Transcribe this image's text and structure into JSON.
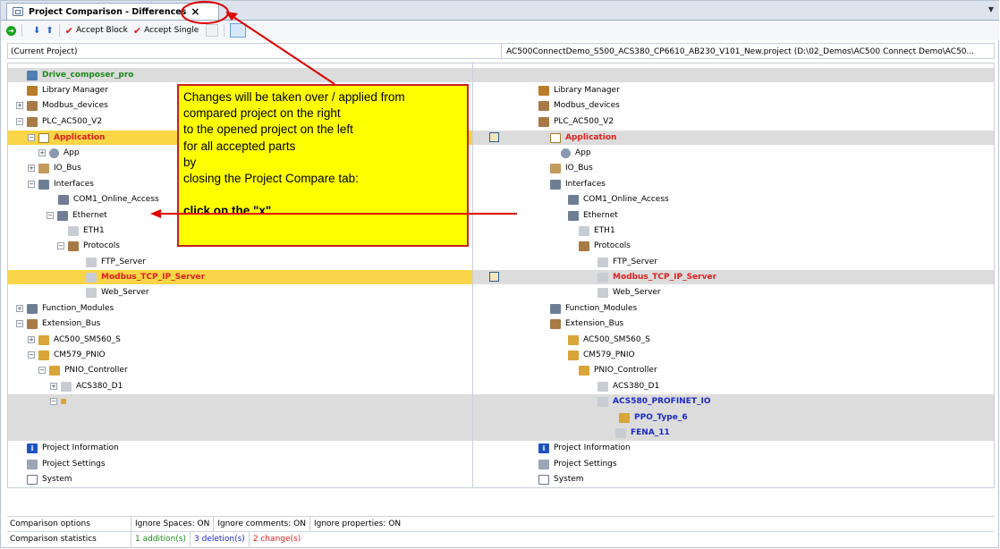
{
  "tab": {
    "title": "Project Comparison - Differences",
    "close": "×"
  },
  "toolbar": {
    "accept_block": "Accept Block",
    "accept_single": "Accept Single"
  },
  "header": {
    "left": "(Current Project)",
    "right": "AC500ConnectDemo_S500_ACS380_CP6610_AB230_V101_New.project (D:\\02_Demos\\AC500 Connect Demo\\AC50..."
  },
  "left_tree": {
    "drive_composer": "Drive_composer_pro",
    "library_manager": "Library Manager",
    "modbus_devices": "Modbus_devices",
    "plc": "PLC_AC500_V2",
    "application": "Application",
    "app": "App",
    "io_bus": "IO_Bus",
    "interfaces": "Interfaces",
    "com1": "COM1_Online_Access",
    "ethernet": "Ethernet",
    "eth1": "ETH1",
    "protocols": "Protocols",
    "ftp": "FTP_Server",
    "modbus_tcp": "Modbus_TCP_IP_Server",
    "web": "Web_Server",
    "function_modules": "Function_Modules",
    "extension_bus": "Extension_Bus",
    "sm560": "AC500_SM560_S",
    "cm579": "CM579_PNIO",
    "pnio_ctrl": "PNIO_Controller",
    "acs380": "ACS380_D1",
    "project_info": "Project Information",
    "project_settings": "Project Settings",
    "system": "System"
  },
  "right_tree": {
    "library_manager": "Library Manager",
    "modbus_devices": "Modbus_devices",
    "plc": "PLC_AC500_V2",
    "application": "Application",
    "app": "App",
    "io_bus": "IO_Bus",
    "interfaces": "Interfaces",
    "com1": "COM1_Online_Access",
    "ethernet": "Ethernet",
    "eth1": "ETH1",
    "protocols": "Protocols",
    "ftp": "FTP_Server",
    "modbus_tcp": "Modbus_TCP_IP_Server",
    "web": "Web_Server",
    "function_modules": "Function_Modules",
    "extension_bus": "Extension_Bus",
    "sm560": "AC500_SM560_S",
    "cm579": "CM579_PNIO",
    "pnio_ctrl": "PNIO_Controller",
    "acs380": "ACS380_D1",
    "acs580": "ACS580_PROFINET_IO",
    "ppo": "PPO_Type_6",
    "fena": "FENA_11",
    "project_info": "Project Information",
    "project_settings": "Project Settings",
    "system": "System"
  },
  "callout": {
    "line1": "Changes will be taken over / applied from",
    "line2": "compared project on the right",
    "line3": "to the opened project on the left",
    "line4": "for all accepted parts",
    "line5": "by",
    "line6": "closing the Project Compare tab:",
    "line7": "click on the \"x\""
  },
  "stats": {
    "options_label": "Comparison options",
    "ignore_spaces": "Ignore Spaces: ON",
    "ignore_comments": "Ignore comments: ON",
    "ignore_properties": "Ignore properties: ON",
    "statistics_label": "Comparison statistics",
    "additions": "1 addition(s)",
    "deletions": "3 deletion(s)",
    "changes": "2 change(s)"
  },
  "colors": {
    "addition": "#1c8a1c",
    "deletion": "#1b29c8",
    "change": "#e02020",
    "callout_bg": "#ffff00",
    "annotation": "#e00000"
  }
}
